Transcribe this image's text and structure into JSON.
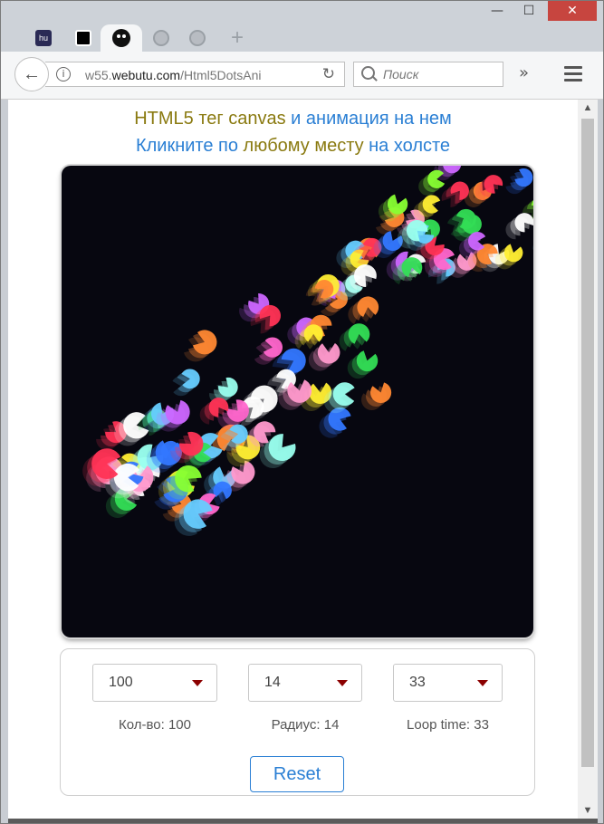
{
  "browser": {
    "window_controls": {
      "minimize": "—",
      "maximize": "☐",
      "close": "✕"
    },
    "tabs": [
      {
        "icon": "hu-favicon-icon",
        "active": false
      },
      {
        "icon": "qr-favicon-icon",
        "active": false
      },
      {
        "icon": "face-favicon-icon",
        "active": true
      },
      {
        "icon": "globe-favicon-icon",
        "active": false
      },
      {
        "icon": "globe-favicon-icon",
        "active": false
      }
    ],
    "new_tab": "+",
    "back": "←",
    "url_prefix": "w55.",
    "url_domain": "webutu.com",
    "url_path": "/Html5DotsAni",
    "reload": "↻",
    "search_placeholder": "Поиск",
    "overflow": "»"
  },
  "page": {
    "heading1": {
      "part1": "HTML5",
      "part2": " тег canvas",
      "part3": " и анимация на нем"
    },
    "heading2": {
      "part1": "Кликните по",
      "part2": " любому месту",
      "part3": " на холсте"
    },
    "controls": {
      "count_value": "100",
      "radius_value": "14",
      "loop_value": "33",
      "count_label": "Кол-во: 100",
      "radius_label": "Радиус: 14",
      "loop_label": "Loop time: 33",
      "reset_label": "Reset"
    },
    "colors": {
      "canvas_bg": "#070710",
      "accent_blue": "#2a7fd4",
      "accent_olive": "#8a7a10",
      "arrow": "#8b0000"
    }
  }
}
